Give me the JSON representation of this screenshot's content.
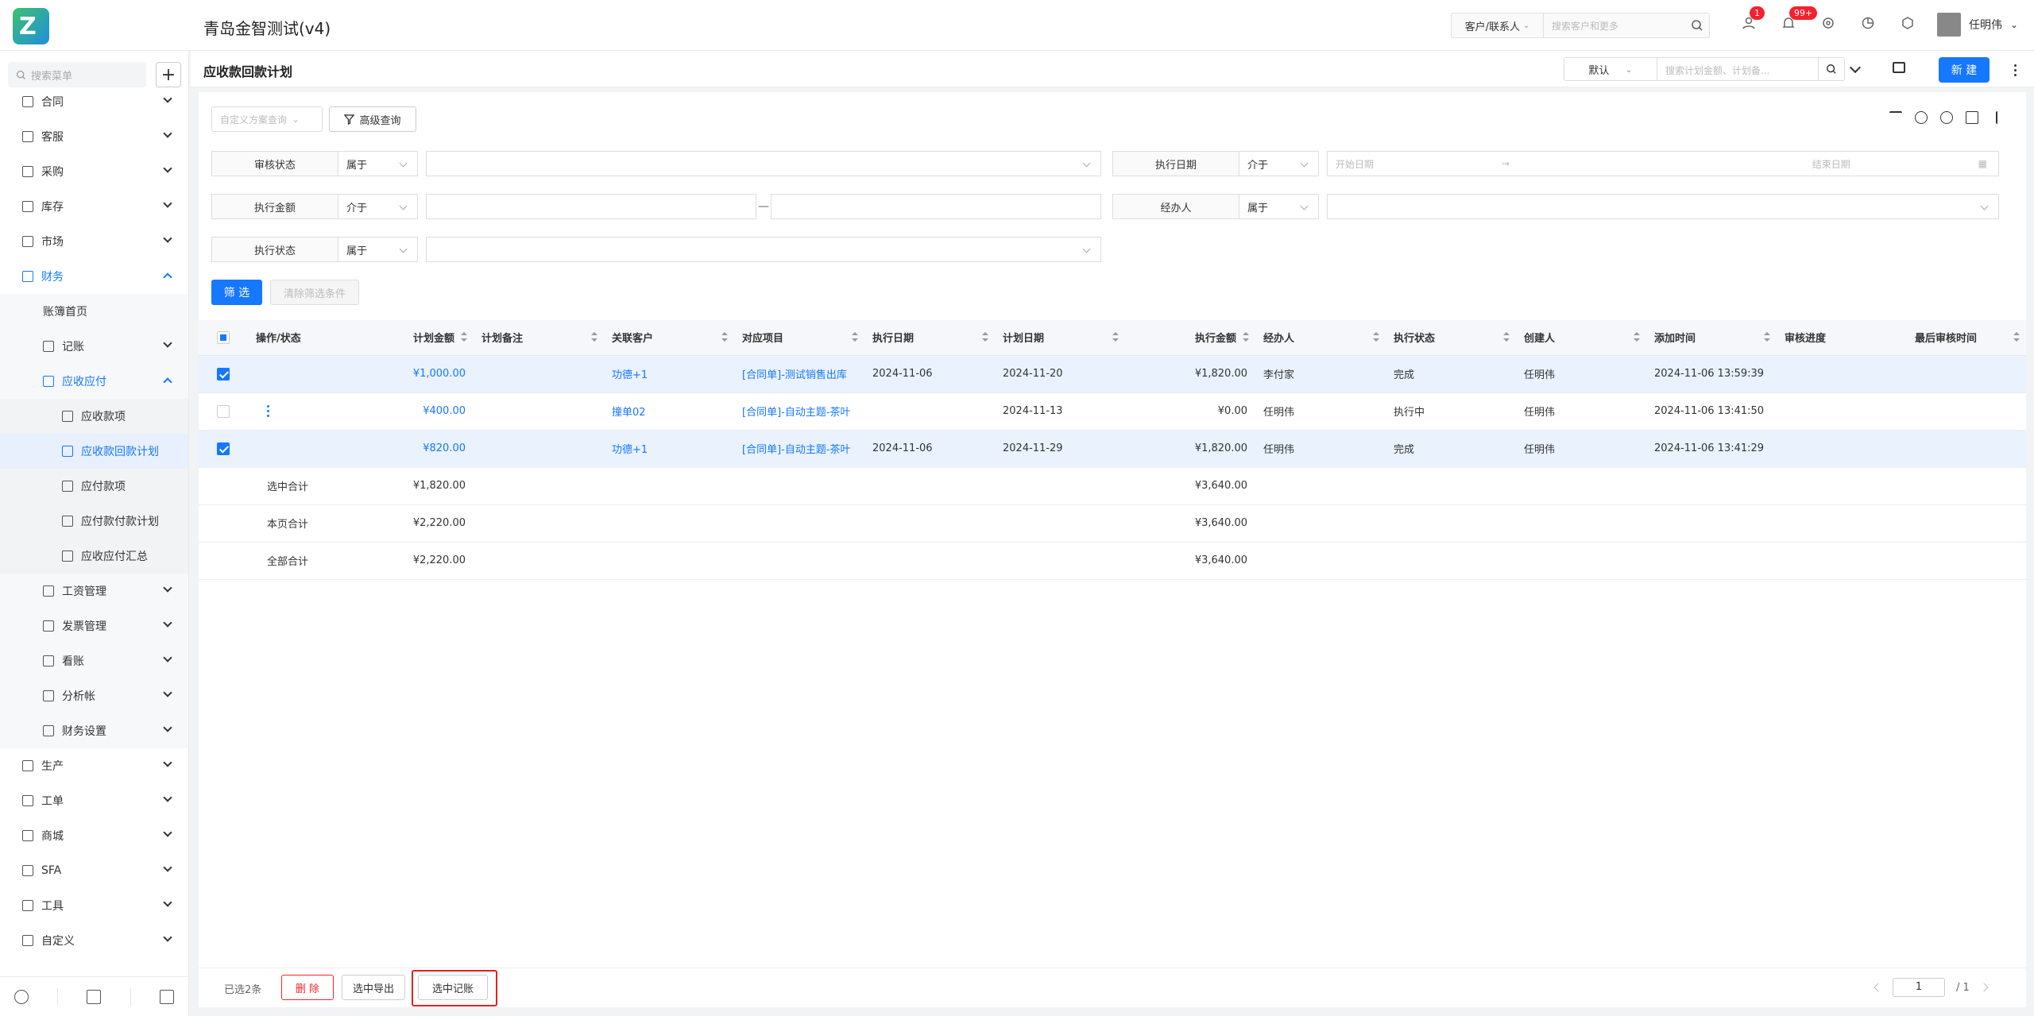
{
  "header": {
    "company": "青岛金智测试(v4)",
    "search_scope": "客户/联系人",
    "search_placeholder": "搜索客户和更多",
    "badge_contacts": "1",
    "badge_notifications": "99+",
    "user_name": "任明伟"
  },
  "sidebar": {
    "search_placeholder": "搜索菜单",
    "items": [
      {
        "label": "合同",
        "level": 0,
        "icon": "contract-icon"
      },
      {
        "label": "客服",
        "level": 0,
        "icon": "headset-icon"
      },
      {
        "label": "采购",
        "level": 0,
        "icon": "purchase-icon"
      },
      {
        "label": "库存",
        "level": 0,
        "icon": "warehouse-icon"
      },
      {
        "label": "市场",
        "level": 0,
        "icon": "market-icon"
      },
      {
        "label": "财务",
        "level": 0,
        "icon": "finance-icon"
      },
      {
        "label": "账簿首页",
        "level": 1,
        "icon": ""
      },
      {
        "label": "记账",
        "level": 1,
        "icon": "ledger-icon"
      },
      {
        "label": "应收应付",
        "level": 1,
        "icon": "receivable-icon"
      },
      {
        "label": "应收款项",
        "level": 2,
        "icon": "gear-icon"
      },
      {
        "label": "应收款回款计划",
        "level": 2,
        "icon": "plan-icon"
      },
      {
        "label": "应付款项",
        "level": 2,
        "icon": "home-icon"
      },
      {
        "label": "应付款付款计划",
        "level": 2,
        "icon": "plan-icon"
      },
      {
        "label": "应收应付汇总",
        "level": 2,
        "icon": "gear-icon"
      },
      {
        "label": "工资管理",
        "level": 1,
        "icon": "salary-icon"
      },
      {
        "label": "发票管理",
        "level": 1,
        "icon": "invoice-icon"
      },
      {
        "label": "看账",
        "level": 1,
        "icon": "view-ledger-icon"
      },
      {
        "label": "分析帐",
        "level": 1,
        "icon": "analysis-icon"
      },
      {
        "label": "财务设置",
        "level": 1,
        "icon": "finance-settings-icon"
      },
      {
        "label": "生产",
        "level": 0,
        "icon": "production-icon"
      },
      {
        "label": "工单",
        "level": 0,
        "icon": "workorder-icon"
      },
      {
        "label": "商城",
        "level": 0,
        "icon": "mall-icon"
      },
      {
        "label": "SFA",
        "level": 0,
        "icon": "sfa-icon"
      },
      {
        "label": "工具",
        "level": 0,
        "icon": "tools-icon"
      },
      {
        "label": "自定义",
        "level": 0,
        "icon": "custom-icon"
      }
    ]
  },
  "page": {
    "title": "应收款回款计划",
    "view_select": "默认",
    "search_placeholder": "搜索计划金额、计划备...",
    "new_button": "新 建"
  },
  "filters": {
    "plan_placeholder": "自定义方案查询",
    "advanced": "高级查询",
    "rows": [
      {
        "label": "审核状态",
        "op": "属于"
      },
      {
        "label": "执行日期",
        "op": "介于",
        "start": "开始日期",
        "end": "结束日期"
      },
      {
        "label": "执行金额",
        "op": "介于"
      },
      {
        "label": "经办人",
        "op": "属于"
      },
      {
        "label": "执行状态",
        "op": "属于"
      }
    ],
    "filter_btn": "筛 选",
    "clear_btn": "清除筛选条件"
  },
  "table": {
    "columns": [
      "操作/状态",
      "计划金额",
      "计划备注",
      "关联客户",
      "对应项目",
      "执行日期",
      "计划日期",
      "执行金额",
      "经办人",
      "执行状态",
      "创建人",
      "添加时间",
      "审核进度",
      "最后审核时间"
    ],
    "rows": [
      {
        "checked": true,
        "amount": "¥1,000.00",
        "note": "",
        "customer": "功德+1",
        "project": "[合同单]-测试销售出库",
        "exec_date": "2024-11-06",
        "plan_date": "2024-11-20",
        "exec_amount": "¥1,820.00",
        "handler": "李付家",
        "status": "完成",
        "creator": "任明伟",
        "added": "2024-11-06 13:59:39",
        "progress": "",
        "last_audit": ""
      },
      {
        "checked": false,
        "amount": "¥400.00",
        "note": "",
        "customer": "撞单02",
        "project": "[合同单]-自动主题-茶叶",
        "exec_date": "",
        "plan_date": "2024-11-13",
        "exec_amount": "¥0.00",
        "handler": "任明伟",
        "status": "执行中",
        "creator": "任明伟",
        "added": "2024-11-06 13:41:50",
        "progress": "",
        "last_audit": ""
      },
      {
        "checked": true,
        "amount": "¥820.00",
        "note": "",
        "customer": "功德+1",
        "project": "[合同单]-自动主题-茶叶",
        "exec_date": "2024-11-06",
        "plan_date": "2024-11-29",
        "exec_amount": "¥1,820.00",
        "handler": "任明伟",
        "status": "完成",
        "creator": "任明伟",
        "added": "2024-11-06 13:41:29",
        "progress": "",
        "last_audit": ""
      }
    ],
    "totals": [
      {
        "label": "选中合计",
        "amount": "¥1,820.00",
        "exec_amount": "¥3,640.00"
      },
      {
        "label": "本页合计",
        "amount": "¥2,220.00",
        "exec_amount": "¥3,640.00"
      },
      {
        "label": "全部合计",
        "amount": "¥2,220.00",
        "exec_amount": "¥3,640.00"
      }
    ]
  },
  "footer": {
    "selected": "已选2条",
    "delete": "删 除",
    "export": "选中导出",
    "account": "选中记账",
    "page": "1",
    "total_pages": "/  1"
  },
  "colors": {
    "primary": "#1677ff",
    "danger": "#f5222d",
    "highlight": "#e02020"
  }
}
